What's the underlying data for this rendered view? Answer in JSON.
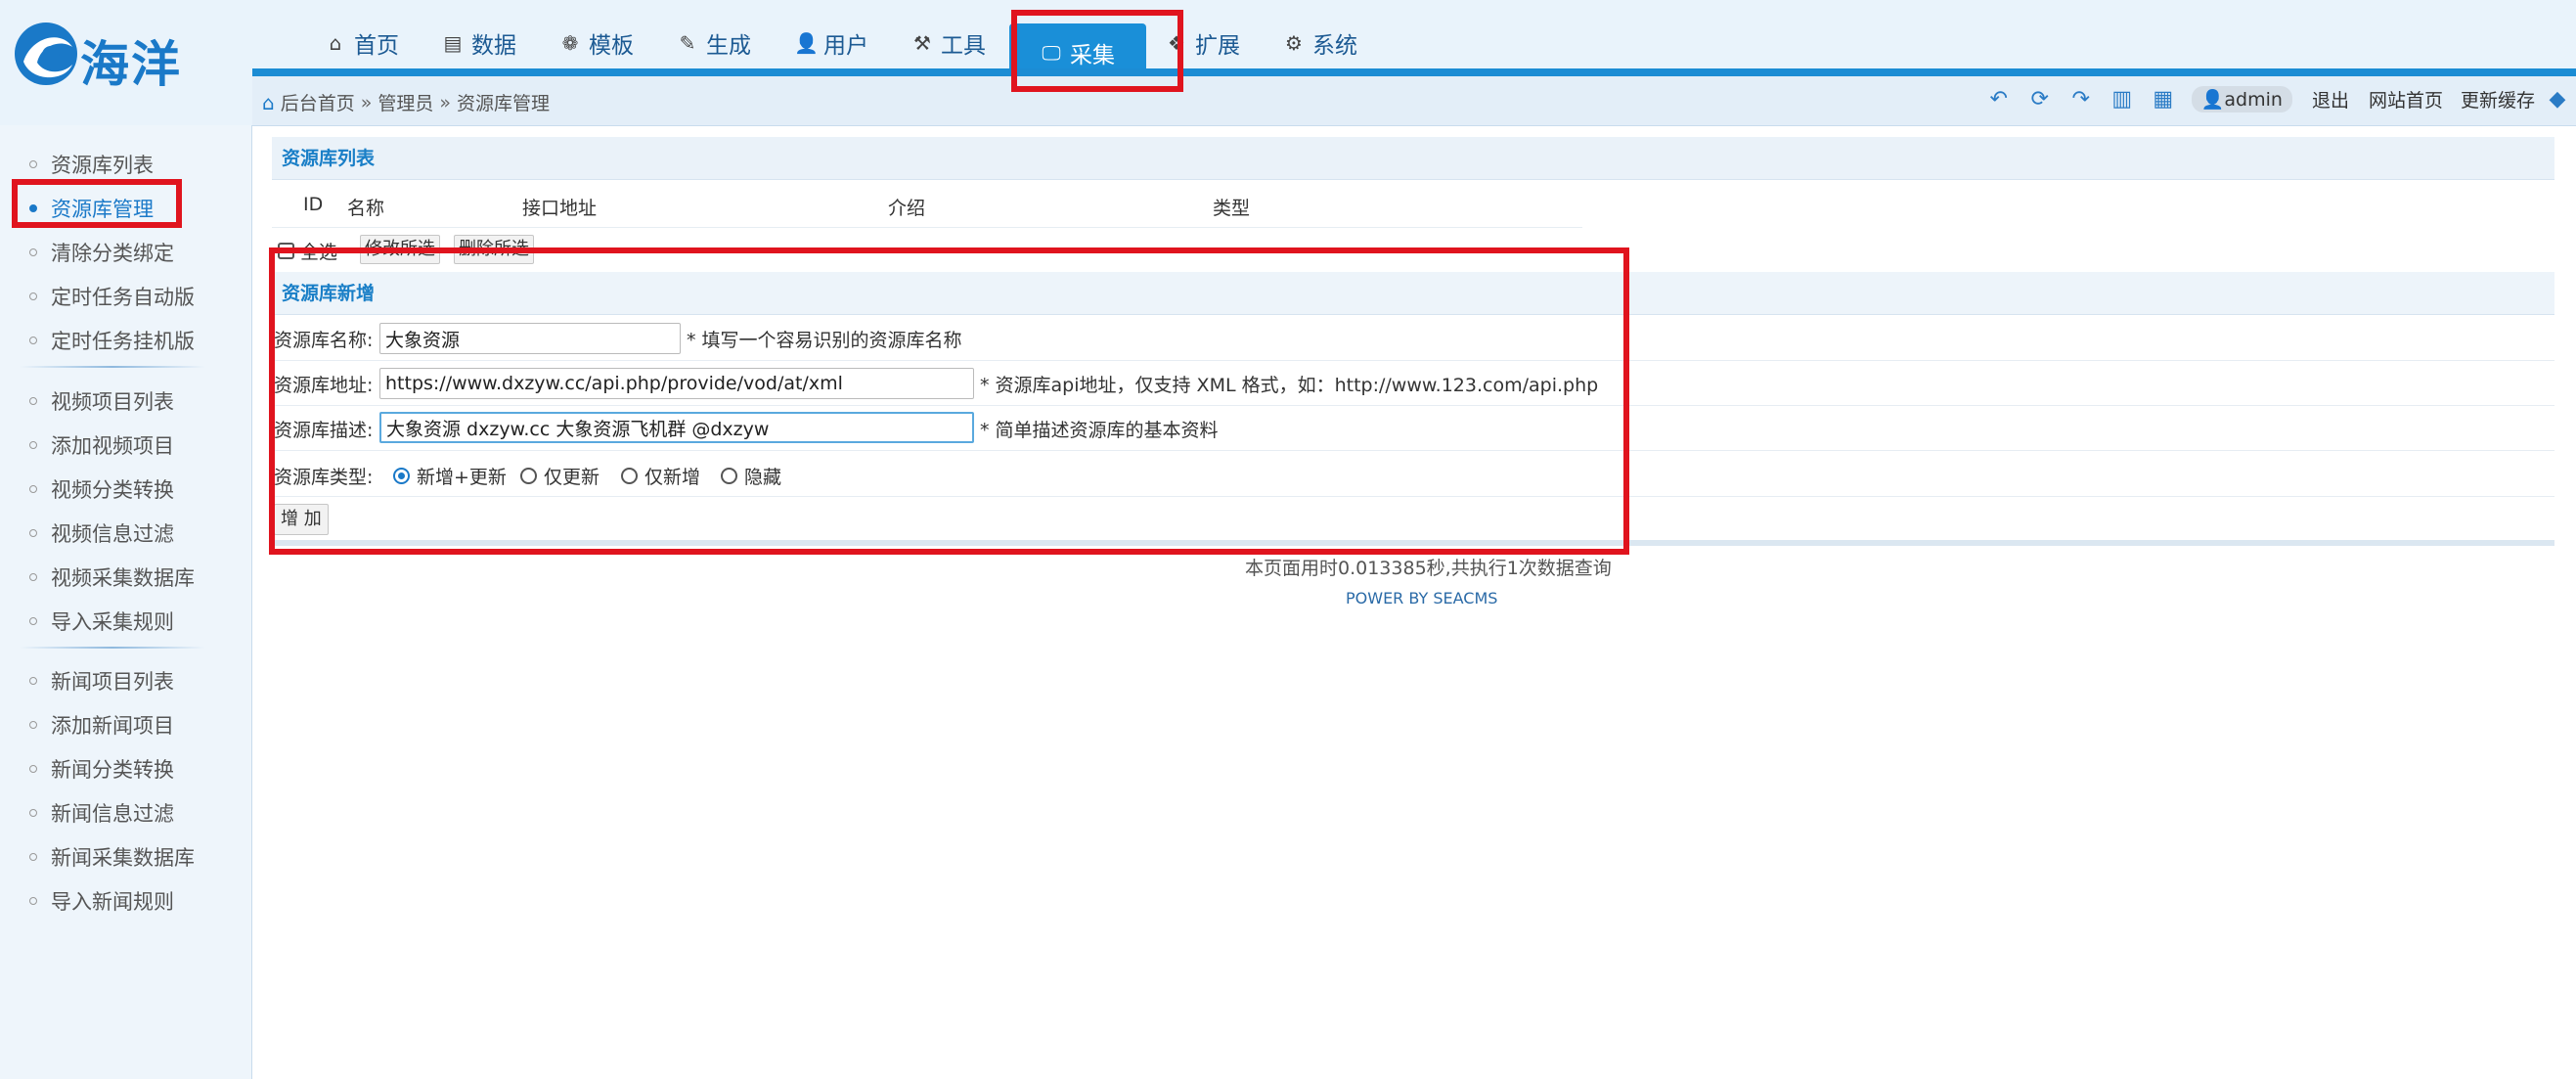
{
  "logo": {
    "text": "海洋"
  },
  "topnav": [
    {
      "label": "首页",
      "icon": "home-icon",
      "glyph": "⌂"
    },
    {
      "label": "数据",
      "icon": "database-icon",
      "glyph": "▤"
    },
    {
      "label": "模板",
      "icon": "palette-icon",
      "glyph": "❁"
    },
    {
      "label": "生成",
      "icon": "edit-icon",
      "glyph": "✎"
    },
    {
      "label": "用户",
      "icon": "user-icon",
      "glyph": "👤"
    },
    {
      "label": "工具",
      "icon": "tools-icon",
      "glyph": "⚒"
    },
    {
      "label": "采集",
      "icon": "monitor-icon",
      "glyph": "🖵",
      "active": true
    },
    {
      "label": "扩展",
      "icon": "puzzle-icon",
      "glyph": "❖"
    },
    {
      "label": "系统",
      "icon": "gear-icon",
      "glyph": "⚙"
    }
  ],
  "breadcrumb": {
    "home": "后台首页",
    "sep1": "»",
    "level2": "管理员",
    "sep2": "»",
    "current": "资源库管理"
  },
  "topright": {
    "user": "admin",
    "logout": "退出",
    "site_home": "网站首页",
    "update_cache": "更新缓存"
  },
  "sidebar": {
    "group1": [
      "资源库列表",
      "资源库管理",
      "清除分类绑定",
      "定时任务自动版",
      "定时任务挂机版"
    ],
    "group2": [
      "视频项目列表",
      "添加视频项目",
      "视频分类转换",
      "视频信息过滤",
      "视频采集数据库",
      "导入采集规则"
    ],
    "group3": [
      "新闻项目列表",
      "添加新闻项目",
      "新闻分类转换",
      "新闻信息过滤",
      "新闻采集数据库",
      "导入新闻规则"
    ],
    "active": "资源库管理"
  },
  "list_panel": {
    "title": "资源库列表",
    "columns": [
      "ID",
      "名称",
      "接口地址",
      "介绍",
      "类型"
    ],
    "select_all": "全选",
    "modify_selected": "修改所选",
    "delete_selected": "删除所选"
  },
  "add_panel": {
    "title": "资源库新增",
    "name_label": "资源库名称:",
    "name_value": "大象资源",
    "name_hint": "* 填写一个容易识别的资源库名称",
    "url_label": "资源库地址:",
    "url_value": "https://www.dxzyw.cc/api.php/provide/vod/at/xml",
    "url_hint": "* 资源库api地址，仅支持 XML 格式，如：http://www.123.com/api.php",
    "desc_label": "资源库描述:",
    "desc_value": "大象资源 dxzyw.cc 大象资源飞机群 @dxzyw",
    "desc_hint": "* 简单描述资源库的基本资料",
    "type_label": "资源库类型:",
    "type_options": [
      "新增+更新",
      "仅更新",
      "仅新增",
      "隐藏"
    ],
    "type_selected": "新增+更新",
    "submit": "增 加"
  },
  "footer": {
    "time": "本页面用时0.013385秒,共执行1次数据查询",
    "power": "POWER BY SEACMS"
  },
  "colors": {
    "accent": "#1a8fd8",
    "highlight": "#e0141e"
  }
}
